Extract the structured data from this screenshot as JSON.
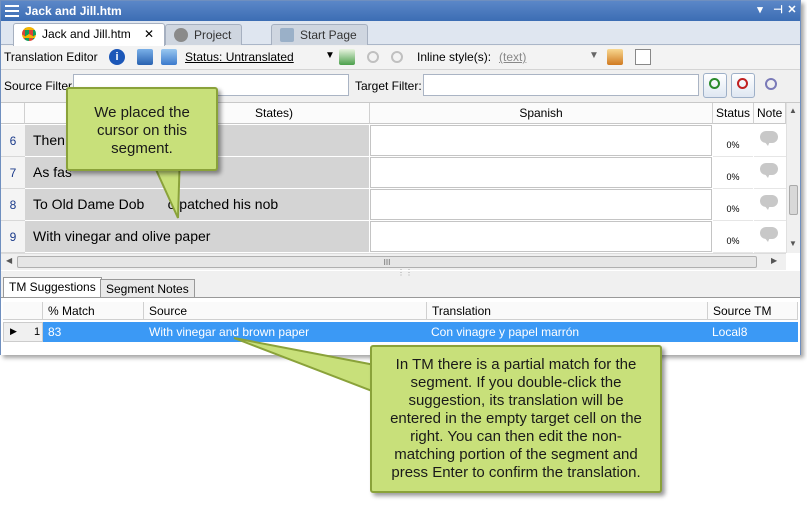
{
  "window": {
    "title": "Jack and Jill.htm"
  },
  "tabs": [
    {
      "label": "Jack and Jill.htm"
    },
    {
      "label": "Project"
    },
    {
      "label": "Start Page"
    }
  ],
  "toolbar": {
    "editor_label": "Translation Editor",
    "status_label": "Status: Untranslated",
    "inline_label": "Inline style(s):",
    "inline_value": "(text)"
  },
  "filters": {
    "source_label": "Source Filter:",
    "target_label": "Target Filter:",
    "source_value": "",
    "target_value": ""
  },
  "grid": {
    "headers": {
      "source": "States)",
      "target": "Spanish",
      "status": "Status",
      "notes": "Note"
    },
    "rows": [
      {
        "num": "6",
        "source": "Then u                       id trot",
        "status": "0%"
      },
      {
        "num": "7",
        "source": "As fas",
        "status": "0%"
      },
      {
        "num": "8",
        "source": "To Old Dame Dob      o patched his nob",
        "status": "0%"
      },
      {
        "num": "9",
        "source": "With vinegar and olive paper",
        "status": "0%"
      }
    ],
    "scroll_handle": "III"
  },
  "bottom_tabs": [
    {
      "label": "TM Suggestions"
    },
    {
      "label": "Segment Notes"
    }
  ],
  "tm": {
    "headers": {
      "match": "% Match",
      "source": "Source",
      "translation": "Translation",
      "source_tm": "Source TM"
    },
    "rows": [
      {
        "num": "1",
        "match": "83",
        "source": "With vinegar and brown paper",
        "translation": "Con vinagre y papel marrón",
        "source_tm": "Local8"
      }
    ]
  },
  "callouts": {
    "cursor": "We placed the cursor on this segment.",
    "tm": "In TM there is a partial match for the segment. If you double-click the suggestion, its translation will be entered in the empty target cell on the right. You can then edit the non-matching portion of the segment and press Enter to confirm the translation."
  },
  "colors": {
    "titlebar": "#3c6db4",
    "selected_row": "#3b99f5",
    "callout_fill": "#c8e07a",
    "callout_border": "#8aa23a"
  }
}
